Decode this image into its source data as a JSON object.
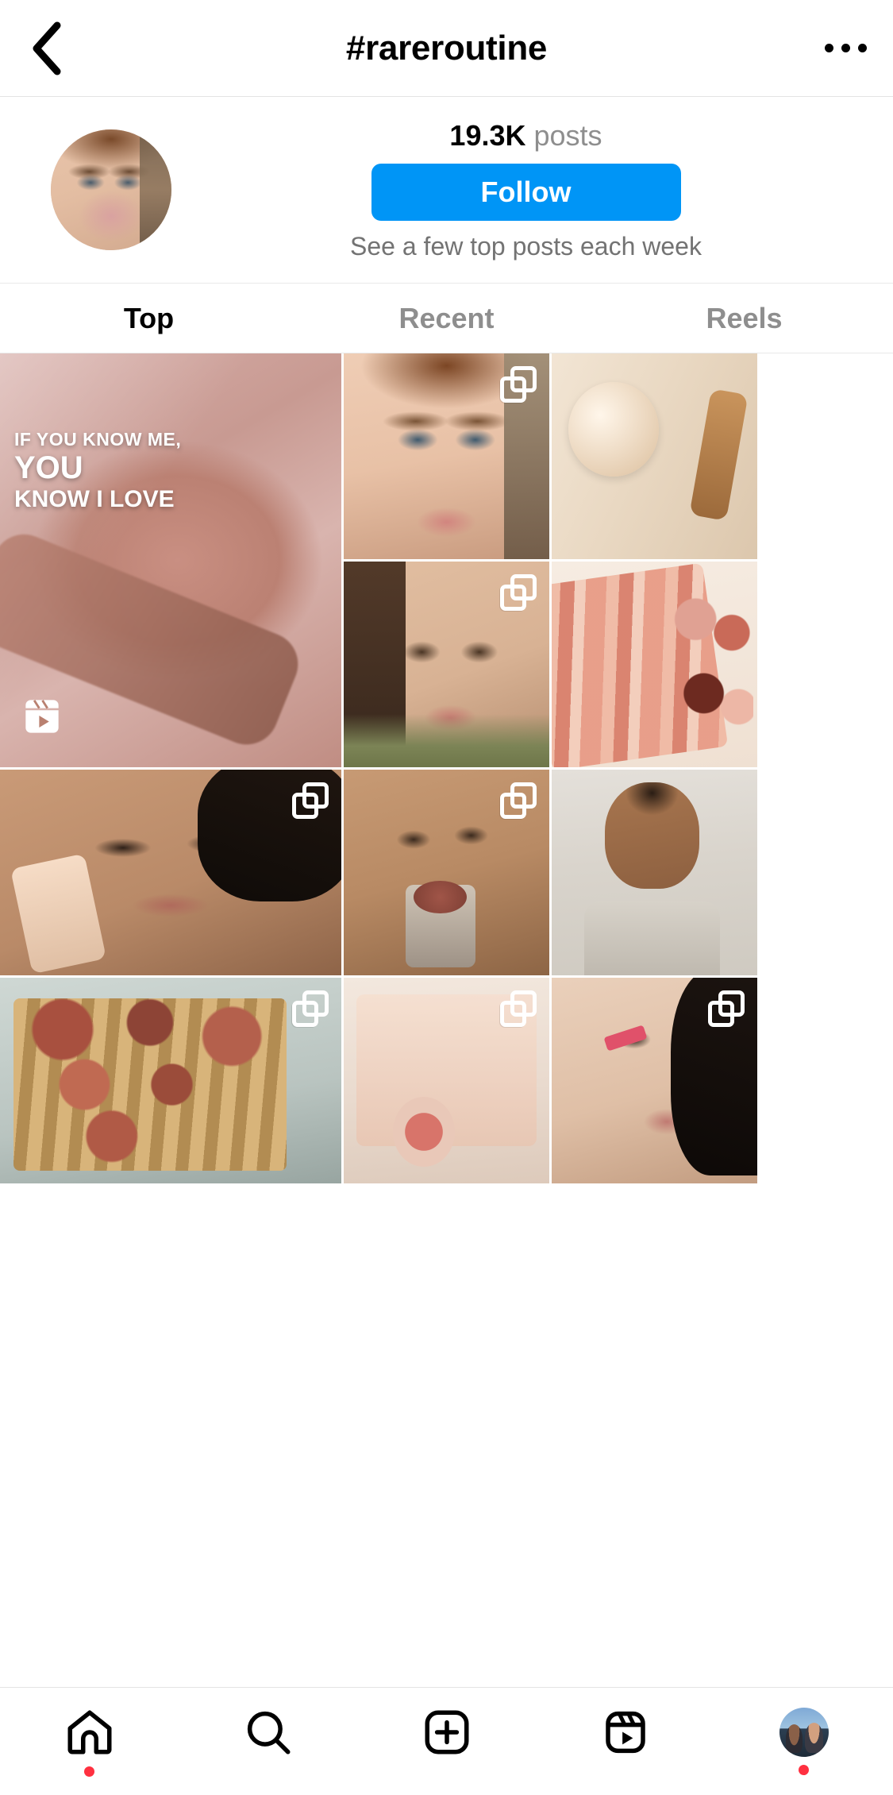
{
  "header": {
    "back_icon": "chevron-left-icon",
    "title": "#rareroutine",
    "more_icon": "more-options-icon"
  },
  "info": {
    "posts_count": "19.3K",
    "posts_label": "posts",
    "follow_label": "Follow",
    "note": "See a few top posts each week",
    "avatar_icon": "hashtag-avatar"
  },
  "tabs": [
    {
      "label": "Top",
      "active": true
    },
    {
      "label": "Recent",
      "active": false
    },
    {
      "label": "Reels",
      "active": false
    }
  ],
  "grid": {
    "feature": {
      "overlay_line1": "IF YOU KNOW ME,",
      "overlay_line2": "YOU",
      "overlay_line3": "KNOW I LOVE",
      "badge": "reels-icon"
    },
    "cells": [
      {
        "name": "post-face-freckles",
        "badge": "carousel-icon"
      },
      {
        "name": "post-rare-beauty-products",
        "badge": "none"
      },
      {
        "name": "post-selfie-brunette",
        "badge": "carousel-icon"
      },
      {
        "name": "post-lip-glosses-row",
        "badge": "none"
      },
      {
        "name": "post-selena-concealer",
        "badge": "carousel-icon"
      },
      {
        "name": "post-blush-application",
        "badge": "carousel-icon"
      },
      {
        "name": "post-mirror-selfie-grey-top",
        "badge": "none"
      },
      {
        "name": "post-lipstick-collection",
        "badge": "carousel-icon"
      },
      {
        "name": "post-product-flatlay",
        "badge": "carousel-icon"
      },
      {
        "name": "post-pink-liner-closeup",
        "badge": "carousel-icon"
      }
    ]
  },
  "bottom_nav": [
    {
      "name": "home",
      "icon": "home-icon",
      "dot": true
    },
    {
      "name": "search",
      "icon": "search-icon",
      "dot": false
    },
    {
      "name": "create",
      "icon": "plus-square-icon",
      "dot": false
    },
    {
      "name": "reels",
      "icon": "reels-icon",
      "dot": false
    },
    {
      "name": "profile",
      "icon": "profile-avatar",
      "dot": true
    }
  ],
  "colors": {
    "accent_blue": "#0095f6",
    "notification_red": "#ff3040",
    "muted_text": "#8e8e8e"
  }
}
